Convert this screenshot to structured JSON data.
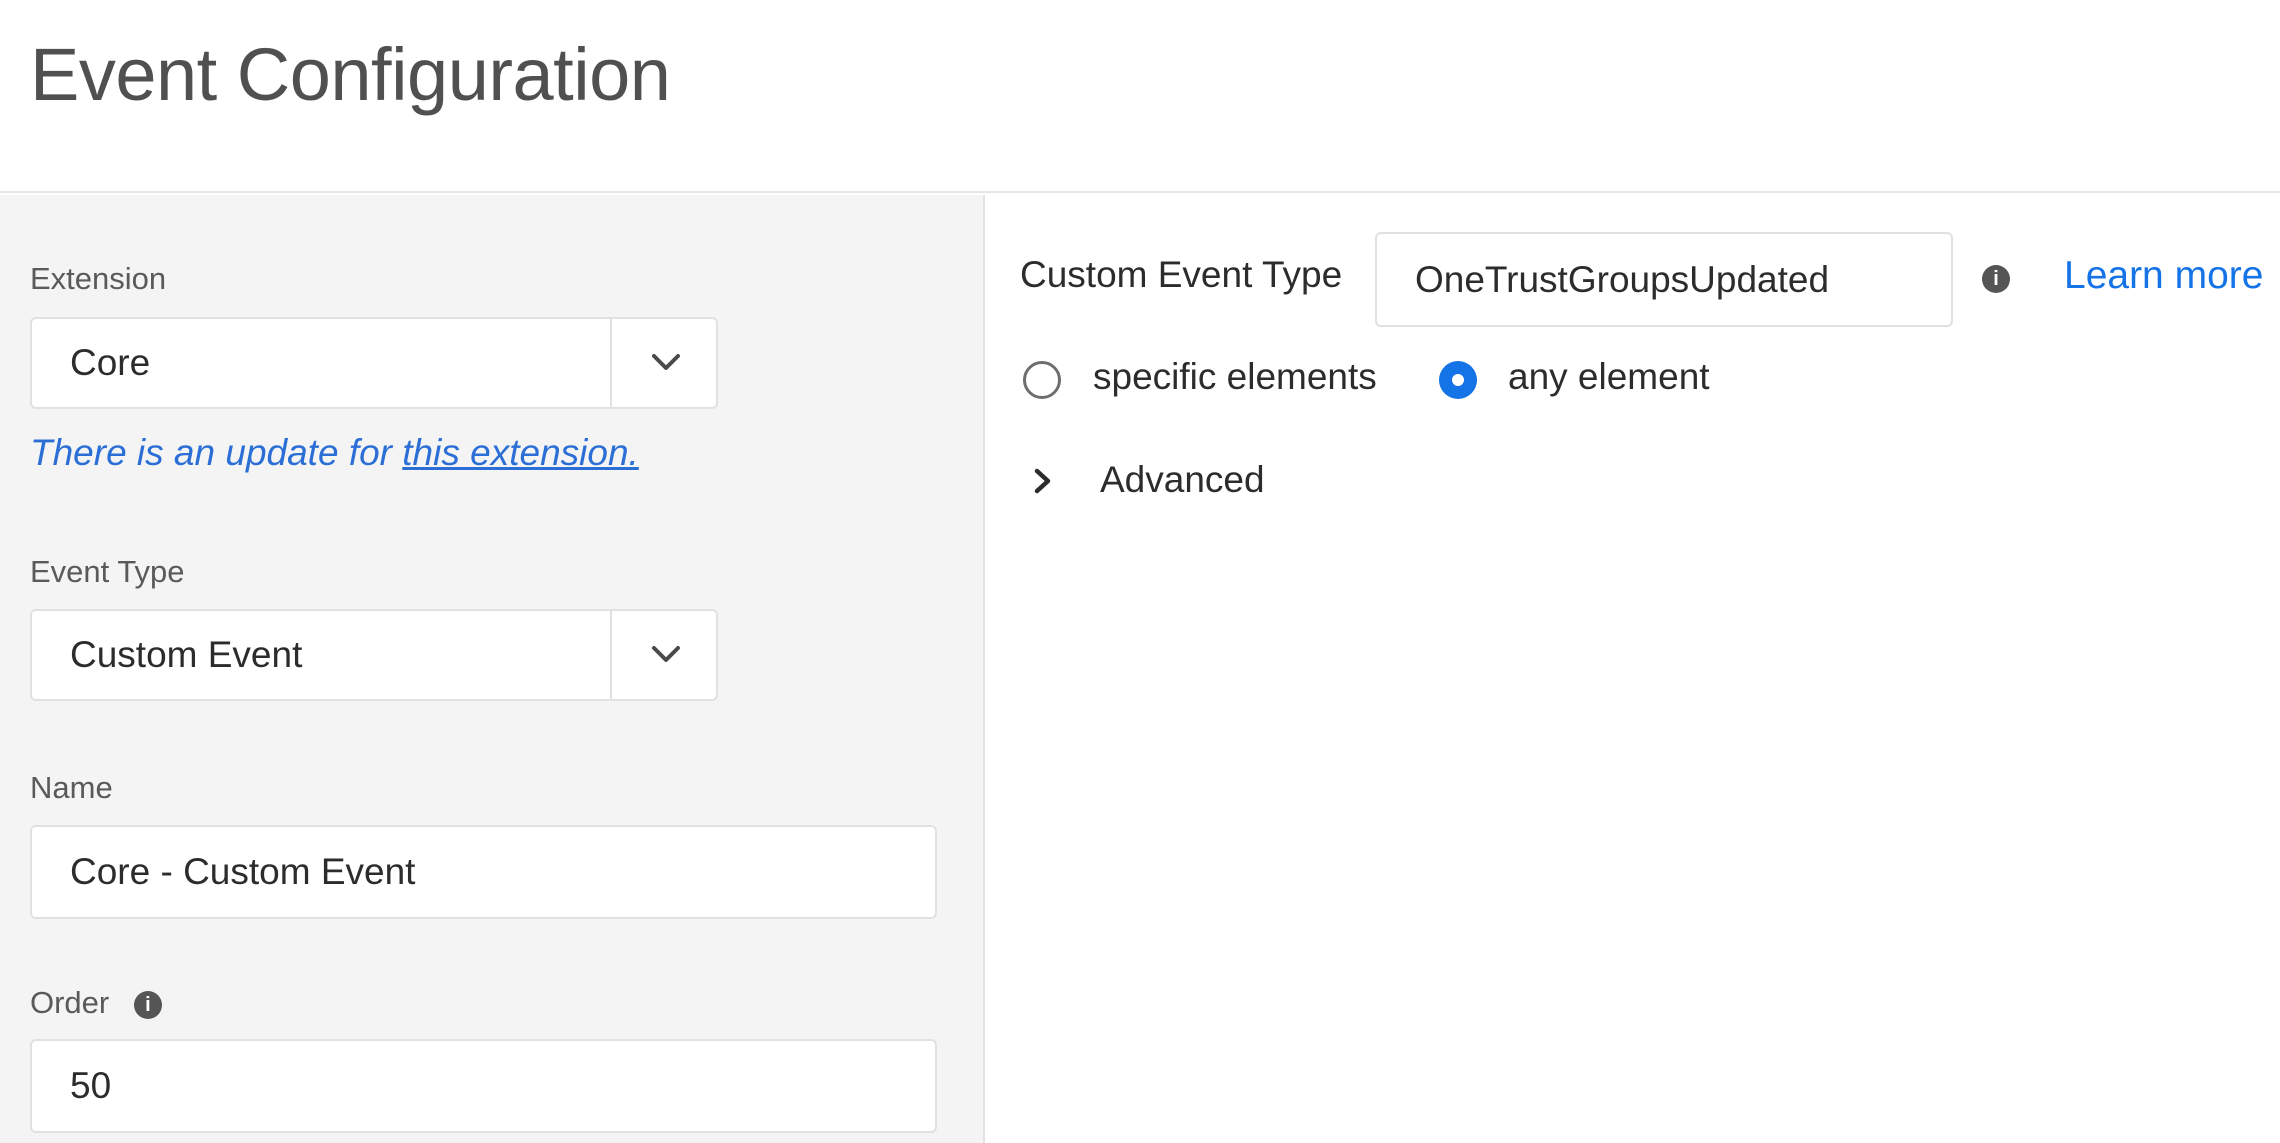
{
  "page": {
    "title": "Event Configuration"
  },
  "left": {
    "extension": {
      "label": "Extension",
      "value": "Core"
    },
    "update_note": {
      "text": "There is an update for ",
      "link": "this extension."
    },
    "event_type": {
      "label": "Event Type",
      "value": "Custom Event"
    },
    "name": {
      "label": "Name",
      "value": "Core - Custom Event"
    },
    "order": {
      "label": "Order",
      "value": "50"
    }
  },
  "right": {
    "custom_event_type": {
      "label": "Custom Event Type",
      "value": "OneTrustGroupsUpdated"
    },
    "learn_more": "Learn more",
    "radios": [
      {
        "label": "specific elements",
        "selected": false
      },
      {
        "label": "any element",
        "selected": true
      }
    ],
    "advanced": {
      "label": "Advanced"
    }
  },
  "info_icon_glyph": "i",
  "colors": {
    "accent": "#1473e6",
    "link": "#2b6fd6",
    "panel_bg": "#f4f4f4"
  }
}
